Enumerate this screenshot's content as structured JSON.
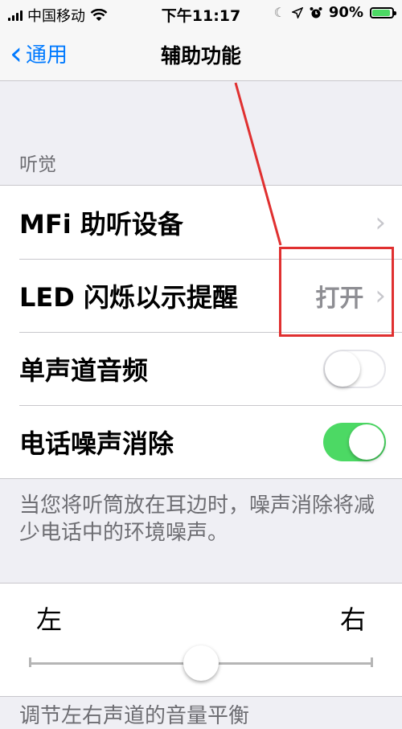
{
  "status_bar": {
    "carrier": "中国移动",
    "time": "下午11:17",
    "battery_percent": "90%",
    "battery_level": 0.9,
    "icons": [
      "signal-icon",
      "wifi-icon",
      "moon-icon",
      "location-icon",
      "alarm-icon",
      "battery-icon"
    ]
  },
  "nav": {
    "back_label": "通用",
    "title": "辅助功能"
  },
  "hearing": {
    "header": "听觉",
    "rows": [
      {
        "label": "MFi 助听设备",
        "value": "",
        "control": "chevron"
      },
      {
        "label": "LED 闪烁以示提醒",
        "value": "打开",
        "control": "chevron"
      },
      {
        "label": "单声道音频",
        "control": "toggle",
        "on": false
      },
      {
        "label": "电话噪声消除",
        "control": "toggle",
        "on": true
      }
    ],
    "footer": "当您将听筒放在耳边时，噪声消除将减少电话中的环境噪声。"
  },
  "balance": {
    "left_label": "左",
    "right_label": "右",
    "value": 0.5
  },
  "next_header": "调节左右声道的音量平衡",
  "colors": {
    "accent": "#007aff",
    "toggle_on": "#4cd964",
    "annotation": "#e03030"
  }
}
